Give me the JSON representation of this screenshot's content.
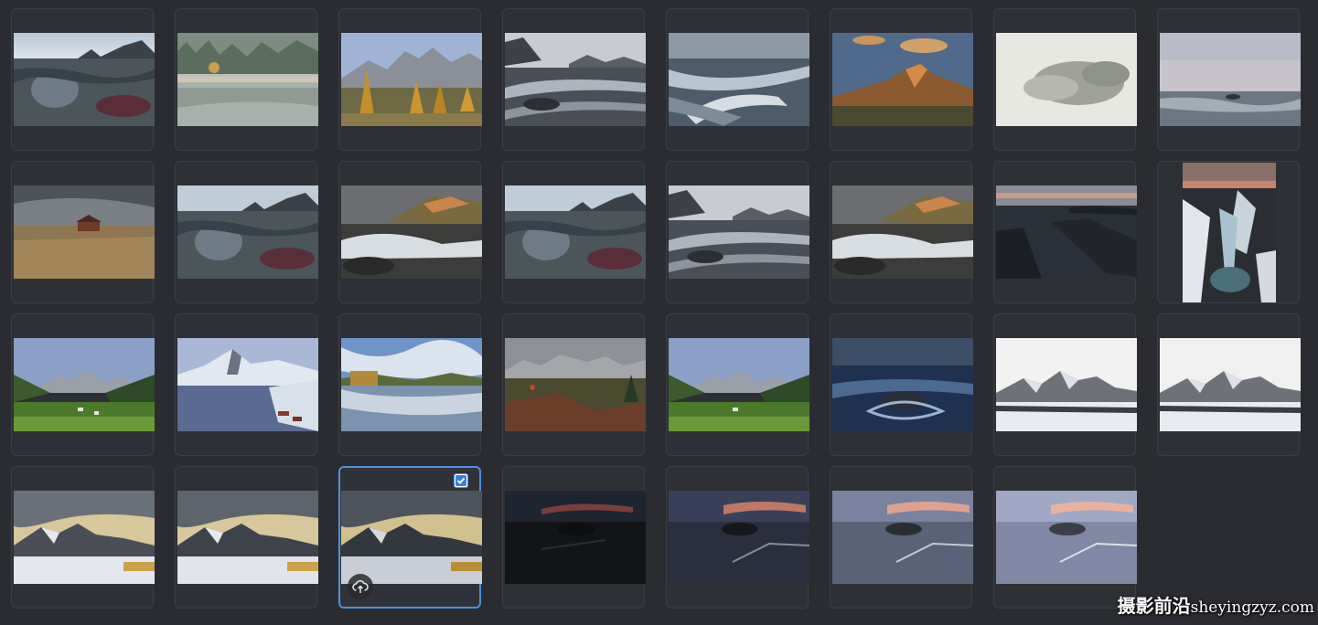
{
  "watermark": {
    "cn_text": "摄影前沿",
    "latin_text": "sheyingzyz.com"
  },
  "photos": [
    {
      "id": "p1",
      "subject": "rocky-coast-puddle",
      "selected": false
    },
    {
      "id": "p2",
      "subject": "foggy-forest-lake",
      "selected": false
    },
    {
      "id": "p3",
      "subject": "autumn-larch-mountains",
      "selected": false
    },
    {
      "id": "p4",
      "subject": "snowy-coast-long-exposure",
      "selected": false
    },
    {
      "id": "p5",
      "subject": "sea-waves-long-exposure",
      "selected": false
    },
    {
      "id": "p6",
      "subject": "dolomites-sunset",
      "selected": false
    },
    {
      "id": "p7",
      "subject": "misty-white-trees",
      "selected": false
    },
    {
      "id": "p8",
      "subject": "pastel-sea-horizon",
      "selected": false
    },
    {
      "id": "p9",
      "subject": "cabin-on-grassland",
      "selected": false
    },
    {
      "id": "p10",
      "subject": "rocky-coast-puddle",
      "selected": false
    },
    {
      "id": "p11",
      "subject": "coast-waves-cliff",
      "selected": false
    },
    {
      "id": "p12",
      "subject": "rocky-coast-puddle",
      "selected": false
    },
    {
      "id": "p13",
      "subject": "snowy-coast-long-exposure",
      "selected": false
    },
    {
      "id": "p14",
      "subject": "coast-waves-cliff",
      "selected": false
    },
    {
      "id": "p15",
      "subject": "dark-rocky-shore",
      "selected": false
    },
    {
      "id": "p16",
      "subject": "frozen-waterfall-portrait",
      "selected": false
    },
    {
      "id": "p17",
      "subject": "green-valley-mountains",
      "selected": false
    },
    {
      "id": "p18",
      "subject": "snowy-fjord-village",
      "selected": false
    },
    {
      "id": "p19",
      "subject": "lake-reflection-clouds",
      "selected": false
    },
    {
      "id": "p20",
      "subject": "alpine-meadow-peaks",
      "selected": false
    },
    {
      "id": "p21",
      "subject": "green-valley-mountains",
      "selected": false
    },
    {
      "id": "p22",
      "subject": "blue-sea-rock",
      "selected": false
    },
    {
      "id": "p23",
      "subject": "snowy-mountain-white",
      "selected": false
    },
    {
      "id": "p24",
      "subject": "snowy-mountain-white",
      "selected": false
    },
    {
      "id": "p25",
      "subject": "snowy-mountain-golden-sky",
      "selected": false
    },
    {
      "id": "p26",
      "subject": "snowy-mountain-golden-sky",
      "selected": false
    },
    {
      "id": "p27",
      "subject": "snowy-mountain-golden-sky",
      "selected": true,
      "upload_icon": "cloud-upload-icon"
    },
    {
      "id": "p28",
      "subject": "dark-sea-dusk",
      "selected": false
    },
    {
      "id": "p29",
      "subject": "sea-dusk-pier",
      "selected": false
    },
    {
      "id": "p30",
      "subject": "sea-dusk-pier",
      "selected": false
    },
    {
      "id": "p31",
      "subject": "sea-dusk-pier",
      "selected": false
    }
  ],
  "colors": {
    "background": "#2a2c31",
    "cell_border": "#3b3e45",
    "selected_border": "#4f8fde"
  }
}
